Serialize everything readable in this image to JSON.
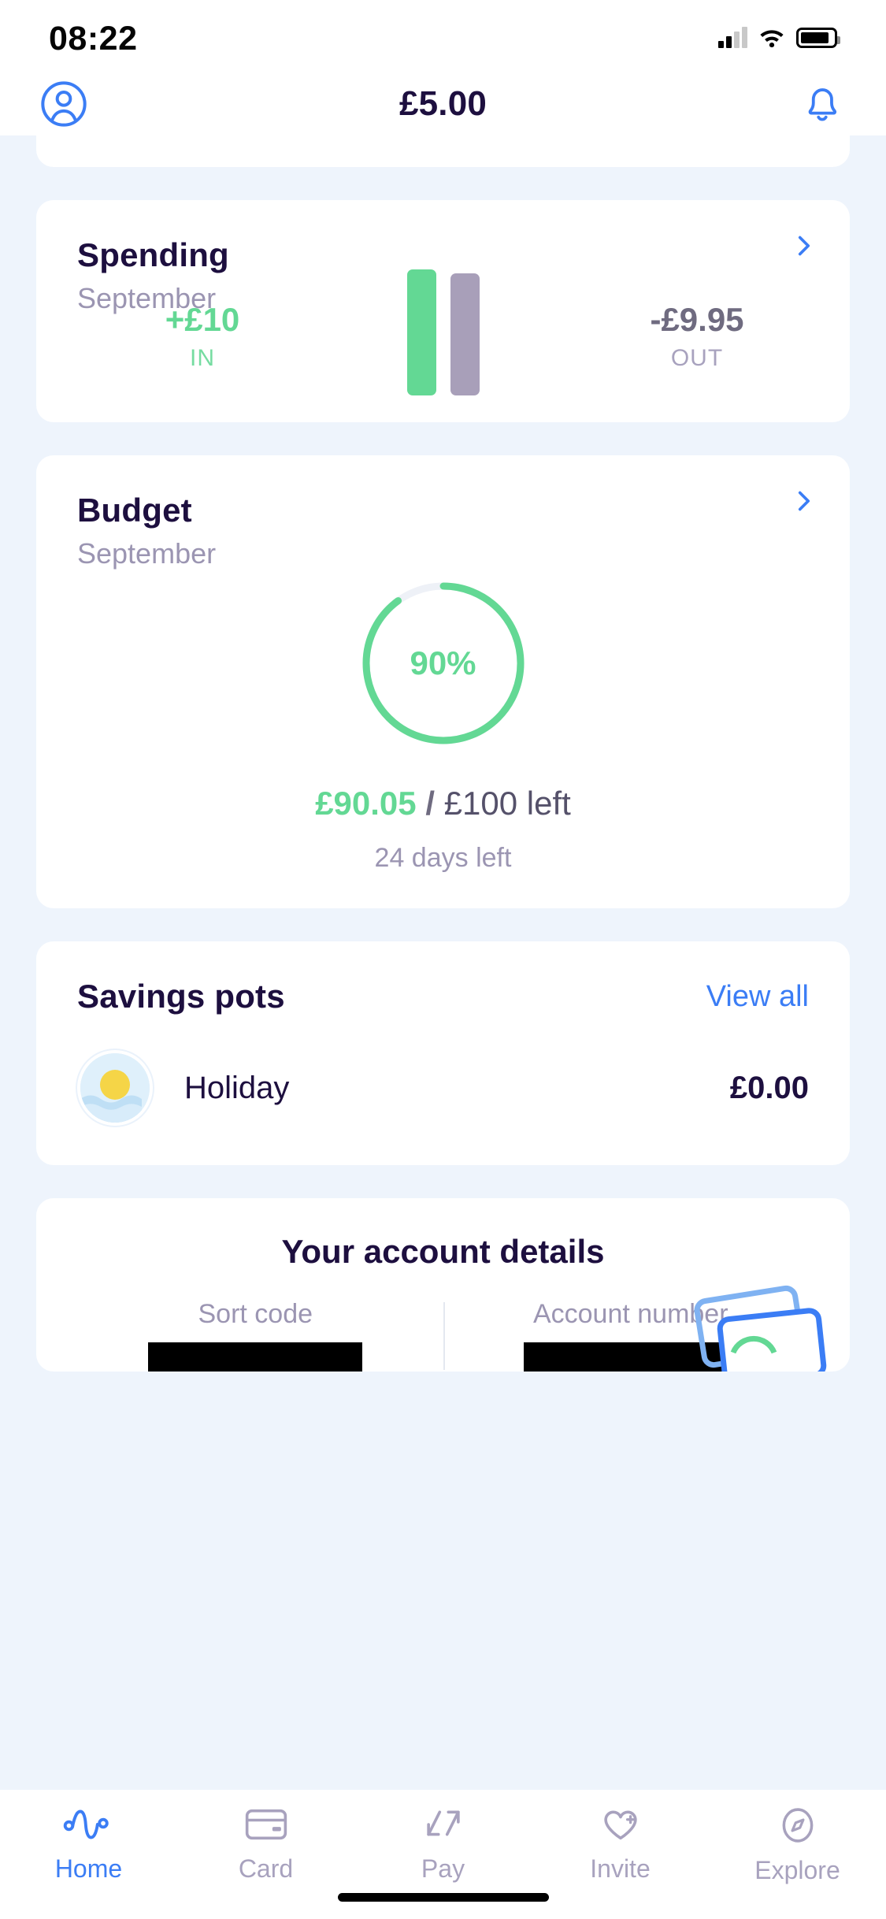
{
  "status_bar": {
    "time": "08:22",
    "signal_icon": "cellular-signal-icon",
    "wifi_icon": "wifi-icon",
    "battery_icon": "battery-icon"
  },
  "header": {
    "profile_icon": "profile-avatar-icon",
    "balance": "£5.00",
    "notifications_icon": "bell-icon"
  },
  "spending": {
    "title": "Spending",
    "month": "September",
    "in_amount": "+£10",
    "in_label": "IN",
    "out_amount": "-£9.95",
    "out_label": "OUT",
    "chevron_icon": "chevron-right-icon",
    "in_color": "#63d894",
    "out_color": "#a89fb9"
  },
  "budget": {
    "title": "Budget",
    "month": "September",
    "percent_label": "90%",
    "percent_value": 90,
    "spent": "£90.05",
    "separator": "/",
    "total": "£100 left",
    "days_left": "24 days left",
    "chevron_icon": "chevron-right-icon",
    "ring_color": "#63d894",
    "track_color": "#eef1f7"
  },
  "savings": {
    "title": "Savings pots",
    "view_all": "View all",
    "pots": [
      {
        "name": "Holiday",
        "amount": "£0.00",
        "image": "beach-sun-pot-image"
      }
    ]
  },
  "account_details": {
    "title": "Your account details",
    "fields": [
      {
        "label": "Sort code",
        "value": "",
        "redacted": true
      },
      {
        "label": "Account number",
        "value": "",
        "redacted": true
      }
    ]
  },
  "tabs": [
    {
      "label": "Home",
      "icon": "pulse-wave-icon",
      "active": true
    },
    {
      "label": "Card",
      "icon": "credit-card-icon",
      "active": false
    },
    {
      "label": "Pay",
      "icon": "transfer-arrows-icon",
      "active": false
    },
    {
      "label": "Invite",
      "icon": "heart-plus-icon",
      "active": false
    },
    {
      "label": "Explore",
      "icon": "compass-icon",
      "active": false
    }
  ],
  "colors": {
    "background": "#eef4fc",
    "card": "#ffffff",
    "text_dark": "#1d0f3f",
    "text_muted": "#9b95b2",
    "accent_blue": "#3b7df5",
    "green": "#63d894"
  }
}
